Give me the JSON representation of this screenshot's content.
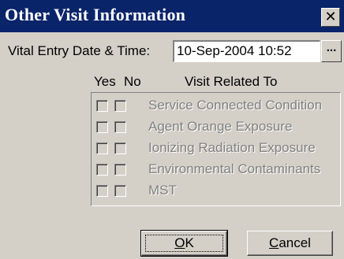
{
  "dialog": {
    "title": "Other Visit Information",
    "close_glyph": "✕"
  },
  "vital_entry": {
    "label": "Vital Entry Date & Time:",
    "value": "10-Sep-2004 10:52",
    "picker_label": "..."
  },
  "visit_related": {
    "header_yes": "Yes",
    "header_no": "No",
    "header_title": "Visit Related To",
    "rows": [
      {
        "label": "Service Connected Condition",
        "yes": false,
        "no": false,
        "enabled": false
      },
      {
        "label": "Agent Orange Exposure",
        "yes": false,
        "no": false,
        "enabled": false
      },
      {
        "label": "Ionizing Radiation Exposure",
        "yes": false,
        "no": false,
        "enabled": false
      },
      {
        "label": "Environmental Contaminants",
        "yes": false,
        "no": false,
        "enabled": false
      },
      {
        "label": "MST",
        "yes": false,
        "no": false,
        "enabled": false
      }
    ]
  },
  "buttons": {
    "ok_mnemonic": "O",
    "ok_rest": "K",
    "cancel_mnemonic": "C",
    "cancel_rest": "ancel"
  },
  "colors": {
    "titlebar": "#0a246a",
    "face": "#d4d0c8",
    "disabled_text": "#808080"
  }
}
